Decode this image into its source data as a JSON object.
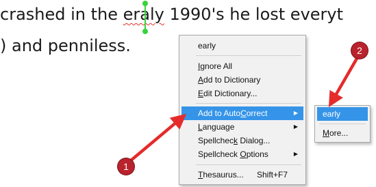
{
  "document": {
    "line1_before": "crashed in the ",
    "line1_misspelled": "eraly",
    "line1_after": " 1990's he lost everyt",
    "line2": ") and penniless."
  },
  "context_menu": {
    "suggestion": "early",
    "items": [
      {
        "label_pre": "",
        "label_u": "I",
        "label_post": "gnore All"
      },
      {
        "label_pre": "",
        "label_u": "A",
        "label_post": "dd to Dictionary"
      },
      {
        "label_pre": "",
        "label_u": "E",
        "label_post": "dit Dictionary..."
      },
      {
        "label_pre": "Add to Auto",
        "label_u": "C",
        "label_post": "orrect"
      },
      {
        "label_pre": "",
        "label_u": "L",
        "label_post": "anguage"
      },
      {
        "label_pre": "Spellchec",
        "label_u": "k",
        "label_post": " Dialog..."
      },
      {
        "label_pre": "Spellcheck ",
        "label_u": "O",
        "label_post": "ptions"
      },
      {
        "label_pre": "",
        "label_u": "T",
        "label_post": "hesaurus...",
        "shortcut": "Shift+F7"
      }
    ]
  },
  "submenu": {
    "suggestion": "early",
    "more_pre": "",
    "more_u": "M",
    "more_post": "ore..."
  },
  "annotations": {
    "badge1": "1",
    "badge2": "2",
    "color": "#e52b2b"
  }
}
